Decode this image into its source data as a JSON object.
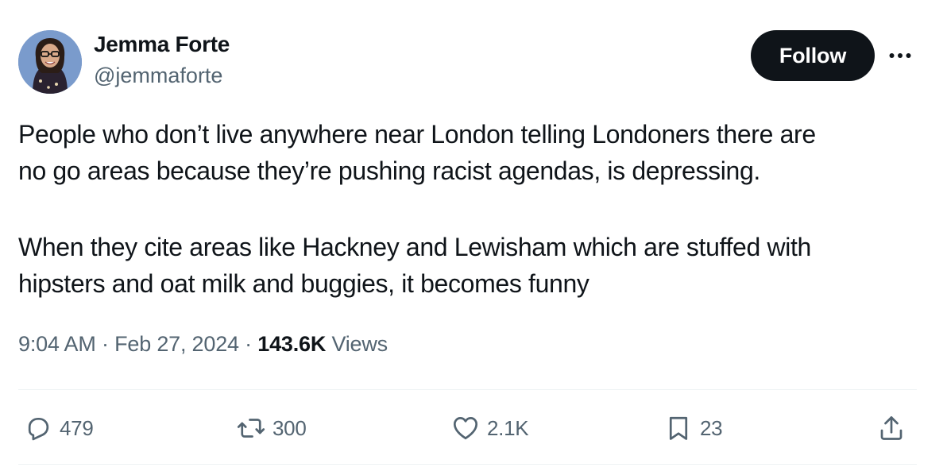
{
  "author": {
    "display_name": "Jemma Forte",
    "handle": "@jemmaforte"
  },
  "header": {
    "follow_label": "Follow",
    "more_icon": "more-horizontal-icon"
  },
  "tweet": {
    "paragraphs": [
      {
        "lines": [
          "People who don’t live anywhere near London telling Londoners there are",
          "no go areas because they’re pushing racist agendas, is depressing."
        ]
      },
      {
        "lines": [
          "When they cite areas like Hackney and Lewisham which are stuffed with",
          "hipsters and oat milk and buggies, it becomes funny"
        ]
      }
    ]
  },
  "meta": {
    "time": "9:04 AM",
    "separator": "·",
    "date": "Feb 27, 2024",
    "views_count": "143.6K",
    "views_label": "Views"
  },
  "actions": {
    "reply": {
      "icon": "reply-icon",
      "count": "479"
    },
    "retweet": {
      "icon": "retweet-icon",
      "count": "300"
    },
    "like": {
      "icon": "heart-icon",
      "count": "2.1K"
    },
    "bookmark": {
      "icon": "bookmark-icon",
      "count": "23"
    },
    "share": {
      "icon": "share-icon"
    }
  },
  "colors": {
    "text_primary": "#0f1419",
    "text_secondary": "#536471",
    "follow_bg": "#0f1419",
    "follow_text": "#ffffff",
    "divider": "#eff3f4"
  }
}
